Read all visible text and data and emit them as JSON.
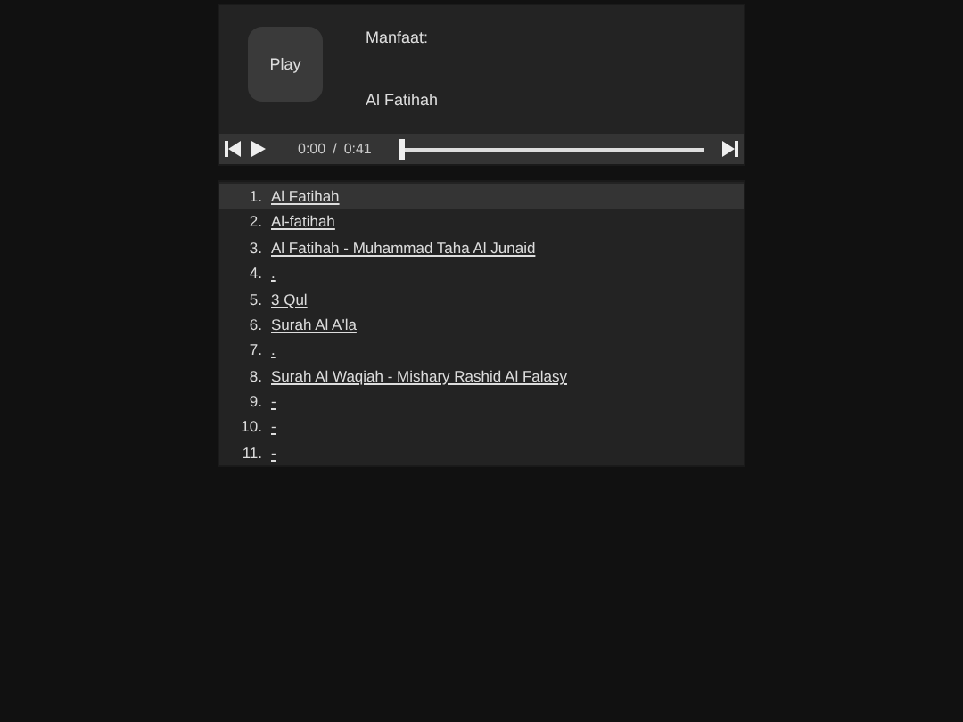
{
  "player": {
    "play_button": "Play",
    "label": "Manfaat:",
    "track_title": "Al Fatihah",
    "current_time": "0:00",
    "separator": "/",
    "duration": "0:41",
    "progress": {
      "level": 0
    }
  },
  "playlist": [
    {
      "number": "1.",
      "title": "Al Fatihah",
      "selected": true
    },
    {
      "number": "2.",
      "title": "Al-fatihah",
      "selected": false
    },
    {
      "number": "3.",
      "title": "Al Fatihah - Muhammad Taha Al Junaid",
      "selected": false
    },
    {
      "number": "4.",
      "title": ".",
      "selected": false
    },
    {
      "number": "5.",
      "title": "3 Qul",
      "selected": false
    },
    {
      "number": "6.",
      "title": "Surah Al A'la",
      "selected": false
    },
    {
      "number": "7.",
      "title": ".",
      "selected": false
    },
    {
      "number": "8.",
      "title": "Surah Al Waqiah - Mishary Rashid Al Falasy",
      "selected": false
    },
    {
      "number": "9.",
      "title": "-",
      "selected": false
    },
    {
      "number": "10.",
      "title": "-",
      "selected": false
    },
    {
      "number": "11.",
      "title": "-",
      "selected": false
    }
  ]
}
